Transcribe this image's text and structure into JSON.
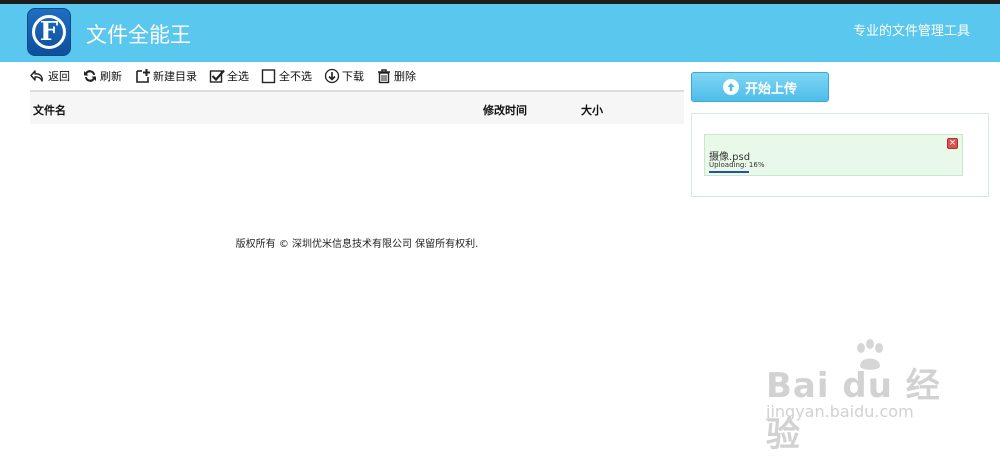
{
  "header": {
    "logo_letter": "F",
    "title": "文件全能王",
    "tagline": "专业的文件管理工具",
    "bg_color": "#5ac7ee"
  },
  "toolbar": {
    "items": [
      {
        "label": "返回",
        "icon": "back-icon"
      },
      {
        "label": "刷新",
        "icon": "refresh-icon"
      },
      {
        "label": "新建目录",
        "icon": "new-folder-icon"
      },
      {
        "label": "全选",
        "icon": "checkbox-checked-icon"
      },
      {
        "label": "全不选",
        "icon": "checkbox-empty-icon"
      },
      {
        "label": "下载",
        "icon": "download-icon"
      },
      {
        "label": "删除",
        "icon": "trash-icon"
      }
    ]
  },
  "file_table": {
    "columns": [
      "文件名",
      "修改时间",
      "大小"
    ],
    "rows": []
  },
  "footer": {
    "copyright": "版权所有 © 深圳优米信息技术有限公司 保留所有权利."
  },
  "upload": {
    "button_label": "开始上传",
    "queue": [
      {
        "filename": "摄像.psd",
        "status": "Uploading:  16%",
        "progress": 0.16
      }
    ]
  },
  "watermark": {
    "main": "Bai du 经验",
    "sub": "jingyan.baidu.com"
  }
}
